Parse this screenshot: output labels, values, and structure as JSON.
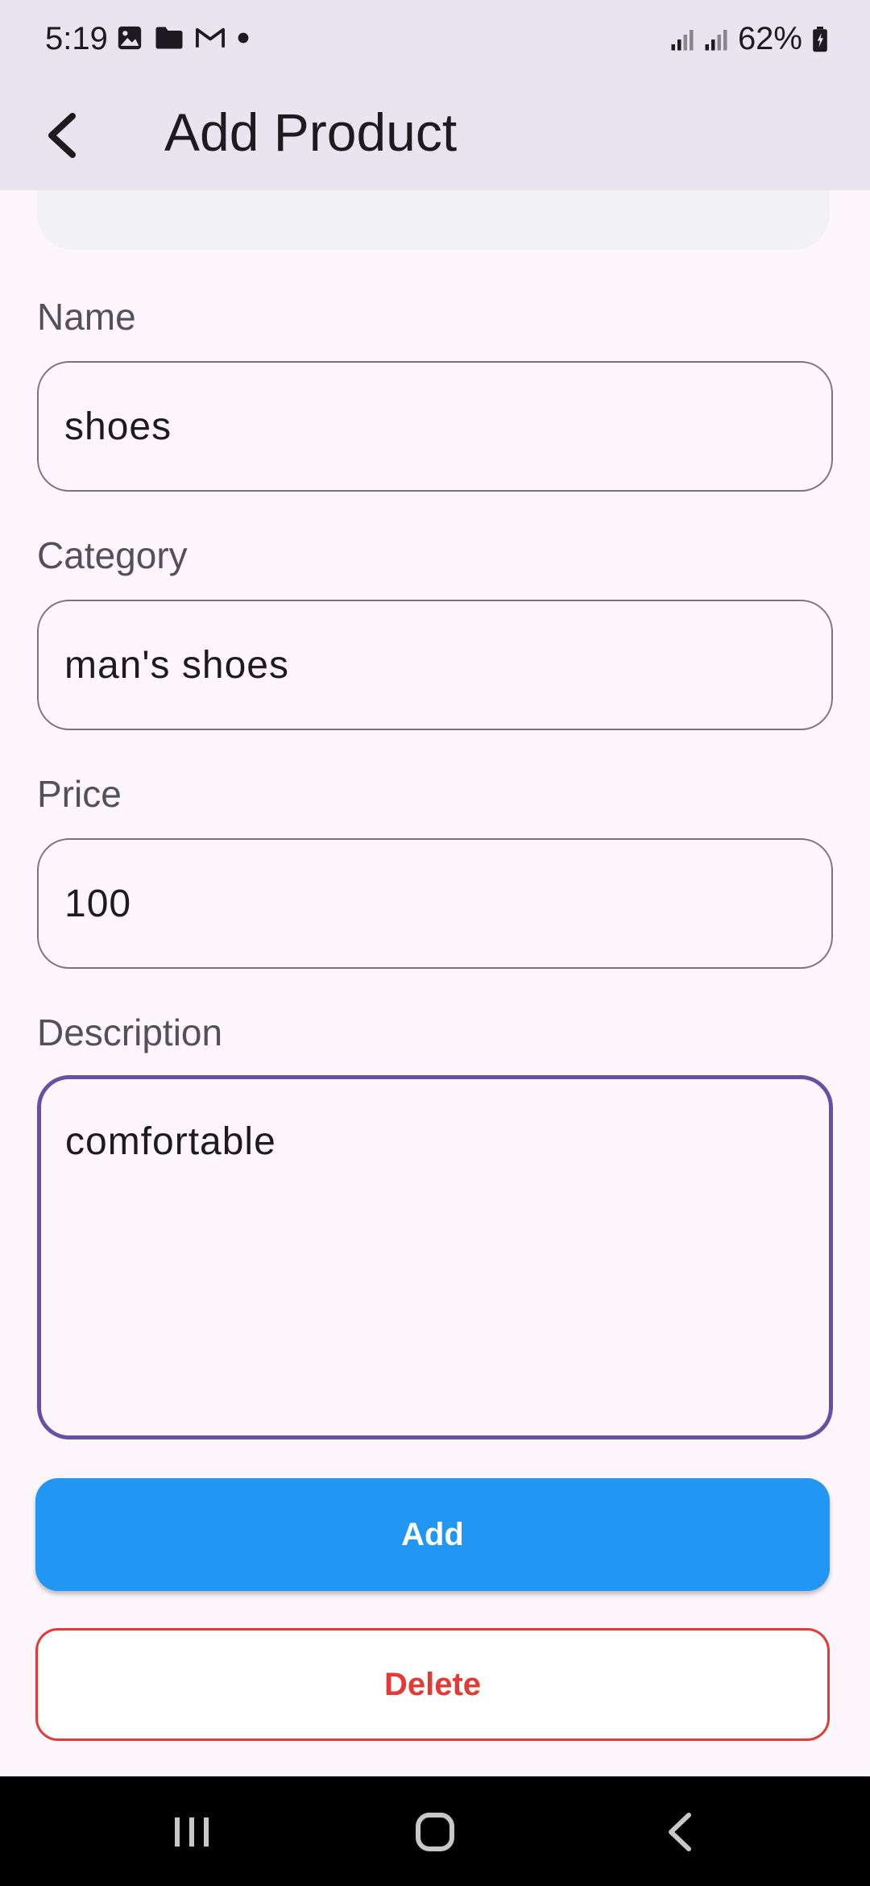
{
  "status_bar": {
    "time": "5:19",
    "battery": "62%",
    "icons": [
      "image-icon",
      "folder-icon",
      "gmail-icon",
      "dot-icon",
      "signal-icon",
      "signal-icon",
      "battery-icon"
    ]
  },
  "app_bar": {
    "title": "Add Product",
    "back_icon": "arrow-back-icon"
  },
  "form": {
    "name": {
      "label": "Name",
      "value": "shoes"
    },
    "category": {
      "label": "Category",
      "value": "man's shoes"
    },
    "price": {
      "label": "Price",
      "value": "100"
    },
    "description": {
      "label": "Description",
      "value": "comfortable"
    }
  },
  "buttons": {
    "add": "Add",
    "delete": "Delete"
  },
  "colors": {
    "accent": "#6750a4",
    "add_button": "#2196f3",
    "delete": "#e53935",
    "app_bar": "#e8e4f0"
  },
  "nav": {
    "icons": [
      "recents-icon",
      "home-icon",
      "back-icon"
    ]
  }
}
